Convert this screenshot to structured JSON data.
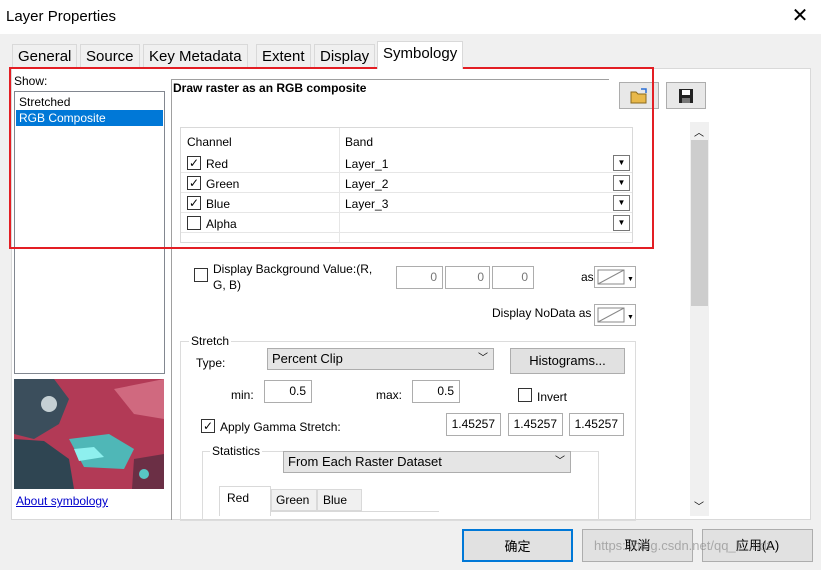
{
  "window": {
    "title": "Layer Properties",
    "close_glyph": "✕"
  },
  "tabs": [
    "General",
    "Source",
    "Key Metadata",
    "Extent",
    "Display",
    "Symbology"
  ],
  "show": {
    "label": "Show:",
    "items": [
      "Stretched",
      "RGB Composite"
    ],
    "selected": "RGB Composite"
  },
  "about_link": "About symbology",
  "heading": "Draw raster as an RGB composite",
  "grid": {
    "headers": [
      "Channel",
      "Band"
    ],
    "rows": [
      {
        "channel": "Red",
        "band": "Layer_1",
        "checked": true
      },
      {
        "channel": "Green",
        "band": "Layer_2",
        "checked": true
      },
      {
        "channel": "Blue",
        "band": "Layer_3",
        "checked": true
      },
      {
        "channel": "Alpha",
        "band": "",
        "checked": false
      }
    ]
  },
  "background": {
    "label_line1": "Display Background Value:(R,",
    "label_line2": "G, B)",
    "r": "0",
    "g": "0",
    "b": "0",
    "as_label": "as"
  },
  "nodata": {
    "label": "Display NoData as"
  },
  "stretch": {
    "group_label": "Stretch",
    "type_label": "Type:",
    "type_value": "Percent Clip",
    "histograms_label": "Histograms...",
    "min_label": "min:",
    "min_value": "0.5",
    "max_label": "max:",
    "max_value": "0.5",
    "invert_label": "Invert",
    "gamma_label": "Apply Gamma Stretch:",
    "gamma_checked": true,
    "gamma_values": [
      "1.45257",
      "1.45257",
      "1.45257"
    ]
  },
  "statistics": {
    "label": "Statistics",
    "value": "From Each Raster Dataset",
    "tabs": [
      "Red",
      "Green",
      "Blue"
    ]
  },
  "footer": {
    "ok": "确定",
    "cancel": "取消",
    "apply": "应用(A)",
    "watermark": "https://blog.csdn.net/qq_li...hdt"
  },
  "colors": {
    "highlight": "#0078d7",
    "annotation_box": "#e31e24",
    "link": "#0000cc"
  }
}
